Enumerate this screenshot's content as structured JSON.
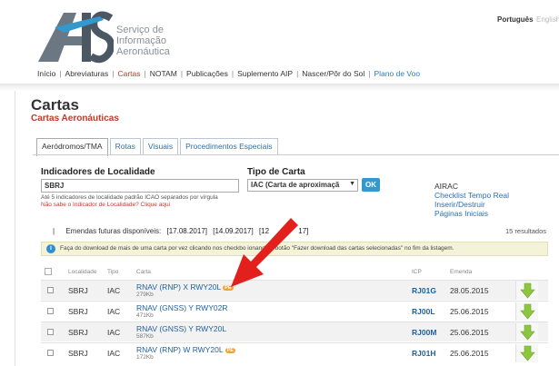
{
  "header": {
    "logo_letters": "AIS",
    "logo_text": [
      "Serviço de",
      "Informação",
      "Aeronáutica"
    ],
    "lang_pt": "Português",
    "lang_en": "English"
  },
  "nav": [
    {
      "label": "Início"
    },
    {
      "label": "Abreviaturas"
    },
    {
      "label": "Cartas"
    },
    {
      "label": "NOTAM"
    },
    {
      "label": "Publicações"
    },
    {
      "label": "Suplemento AIP"
    },
    {
      "label": "Nascer/Pôr do Sol"
    },
    {
      "label": "Plano de Voo"
    }
  ],
  "page": {
    "title": "Cartas",
    "subtitle": "Cartas Aeronáuticas"
  },
  "tabs": [
    "Aeródromos/TMA",
    "Rotas",
    "Visuais",
    "Procedimentos Especiais"
  ],
  "form": {
    "ind_label": "Indicadores de Localidade",
    "ind_value": "SBRJ",
    "hint": "Até 5 indicadores de localidade padrão ICAO separados por vírgula",
    "hint_link": "Não sabe o Indicador de Localidade? Clique aqui",
    "tipo_label": "Tipo de Carta",
    "tipo_value": "IAC (Carta de aproximaçã",
    "ok": "OK"
  },
  "airac": {
    "title": "AIRAC",
    "links": [
      "Checklist Tempo Real",
      "Inserir/Destruir",
      "Páginas Iniciais"
    ]
  },
  "emendas": {
    "bar": "|",
    "label": "Emendas futuras disponíveis:",
    "dates": [
      "[17.08.2017]",
      "[14.09.2017]",
      "[12",
      "17]"
    ],
    "results": "15 resultados"
  },
  "info": {
    "icon": "i",
    "text": "Faça do download de mais de uma carta por vez clicando nos checkbo        ionando o botão \"Fazer download das cartas selecionadas\" no fim da listagem."
  },
  "table": {
    "headers": {
      "loc": "Localidade",
      "tipo": "Tipo",
      "carta": "Carta",
      "icp": "ICP",
      "emenda": "Emenda"
    },
    "rows": [
      {
        "loc": "SBRJ",
        "tipo": "IAC",
        "nome": "RNAV (RNP) X RWY20L",
        "badge": "PE",
        "size": "279Kb",
        "icp": "RJ01G",
        "emenda": "28.05.2015"
      },
      {
        "loc": "SBRJ",
        "tipo": "IAC",
        "nome": "RNAV (GNSS) Y RWY02R",
        "badge": "",
        "size": "471Kb",
        "icp": "RJ00L",
        "emenda": "25.06.2015"
      },
      {
        "loc": "SBRJ",
        "tipo": "IAC",
        "nome": "RNAV (GNSS) Y RWY20L",
        "badge": "",
        "size": "587Kb",
        "icp": "RJ00M",
        "emenda": "25.06.2015"
      },
      {
        "loc": "SBRJ",
        "tipo": "IAC",
        "nome": "RNAV (RNP) W RWY20L",
        "badge": "PE",
        "size": "172Kb",
        "icp": "RJ01H",
        "emenda": "25.06.2015"
      }
    ]
  },
  "colors": {
    "accent_red": "#c0392b",
    "link_blue": "#2a6fb5",
    "download_green": "#8cc63f",
    "arrow_red": "#e3201b"
  }
}
